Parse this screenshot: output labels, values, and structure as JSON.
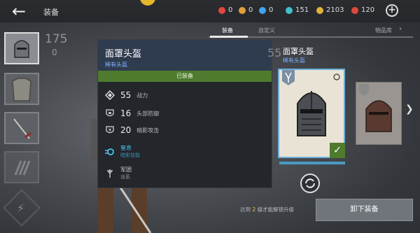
{
  "header": {
    "title": "装备"
  },
  "resources": [
    {
      "value": "0",
      "color": "#e0483e"
    },
    {
      "value": "0",
      "color": "#e0a13a"
    },
    {
      "value": "0",
      "color": "#3fa5ee"
    },
    {
      "value": "151",
      "color": "#3fc1c9"
    },
    {
      "value": "2103",
      "color": "#e2b33a"
    },
    {
      "value": "120",
      "color": "#e0483e"
    }
  ],
  "left_panel": {
    "power": "175",
    "power_sub": "0"
  },
  "tabs": [
    {
      "label": "装备",
      "active": true
    },
    {
      "label": "自定义",
      "active": false
    },
    {
      "label": "物品库",
      "active": false
    }
  ],
  "popup": {
    "title": "面罩头盔",
    "rarity": "稀有头盔",
    "equipped_label": "已装备",
    "stats": [
      {
        "value": "55",
        "label": "战力"
      },
      {
        "value": "16",
        "label": "头部防御"
      },
      {
        "value": "20",
        "label": "暗影攻击"
      }
    ],
    "ability": {
      "name": "窒息",
      "desc": "暗影技能"
    },
    "faction": {
      "name": "军团",
      "desc": "派系"
    }
  },
  "right_panel": {
    "title": "面罩头盔",
    "rarity": "稀有头盔",
    "power_partial": "55"
  },
  "footer": {
    "req_prefix": "达到",
    "req_level": "2",
    "req_suffix": "级才能解锁升级",
    "unequip_label": "卸下装备"
  }
}
